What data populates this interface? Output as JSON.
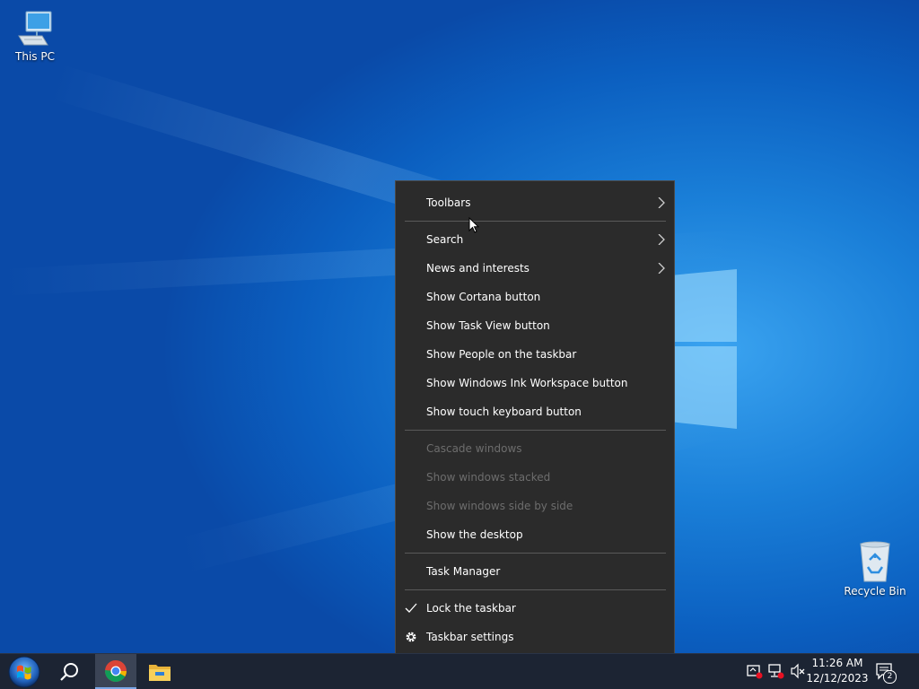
{
  "desktop": {
    "icons": [
      {
        "label": "This PC",
        "icon": "computer-icon"
      },
      {
        "label": "Recycle Bin",
        "icon": "recycle-bin-icon"
      }
    ],
    "accent_color": "#0b6ad0"
  },
  "context_menu": {
    "items": [
      {
        "label": "Toolbars",
        "submenu": true,
        "enabled": true
      },
      {
        "label": "Search",
        "submenu": true,
        "enabled": true
      },
      {
        "label": "News and interests",
        "submenu": true,
        "enabled": true
      },
      {
        "label": "Show Cortana button",
        "enabled": true
      },
      {
        "label": "Show Task View button",
        "enabled": true
      },
      {
        "label": "Show People on the taskbar",
        "enabled": true
      },
      {
        "label": "Show Windows Ink Workspace button",
        "enabled": true
      },
      {
        "label": "Show touch keyboard button",
        "enabled": true
      },
      {
        "label": "Cascade windows",
        "enabled": false
      },
      {
        "label": "Show windows stacked",
        "enabled": false
      },
      {
        "label": "Show windows side by side",
        "enabled": false
      },
      {
        "label": "Show the desktop",
        "enabled": true
      },
      {
        "label": "Task Manager",
        "enabled": true
      },
      {
        "label": "Lock the taskbar",
        "enabled": true,
        "checked": true,
        "icon": "checkmark-icon"
      },
      {
        "label": "Taskbar settings",
        "enabled": true,
        "icon": "gear-icon"
      }
    ],
    "background_color": "#2b2b2b",
    "disabled_text_color": "#6d6d6d"
  },
  "taskbar": {
    "pinned": [
      {
        "name": "start-button",
        "icon": "windows-orb-icon"
      },
      {
        "name": "search-button",
        "icon": "search-icon"
      },
      {
        "name": "chrome-button",
        "icon": "chrome-icon",
        "active": true
      },
      {
        "name": "file-explorer-button",
        "icon": "folder-icon"
      }
    ],
    "tray": {
      "icons": [
        "security-alert-icon",
        "network-icon",
        "volume-muted-icon"
      ],
      "time": "11:26 AM",
      "date": "12/12/2023",
      "notification_count": "2"
    },
    "background_color": "#1c2433"
  }
}
